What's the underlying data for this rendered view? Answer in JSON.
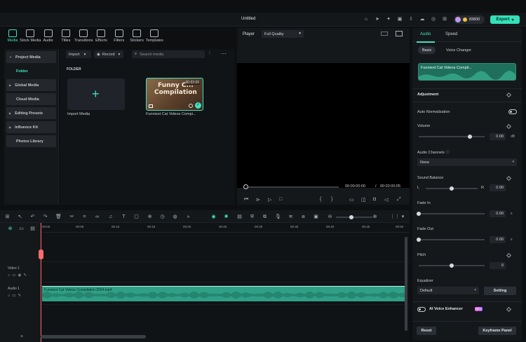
{
  "window": {
    "title": "Untitled"
  },
  "account": {
    "credits": "83830"
  },
  "export": {
    "label": "Export"
  },
  "toolbar": {
    "tools": [
      "Media",
      "Stock Media",
      "Audio",
      "Titles",
      "Transitions",
      "Effects",
      "Filters",
      "Stickers",
      "Templates"
    ],
    "active": "Media"
  },
  "leftnav": {
    "items": [
      "Project Media",
      "Folder",
      "Global Media",
      "Cloud Media",
      "Editing Presets",
      "Influence Kit",
      "Photos Library"
    ]
  },
  "media": {
    "import_label": "Import",
    "record_label": "Record",
    "search_placeholder": "Search media",
    "folder_label": "FOLDER",
    "import_tile_label": "Import Media",
    "clip": {
      "title_line1": "Funny C...",
      "title_line2": "Compilation",
      "duration": "00:02:00",
      "label": "Funniest Cat Videos Compi..."
    }
  },
  "player": {
    "tab": "Player",
    "quality": "Full Quality",
    "current_time": "00:00:00:00",
    "separator": "/",
    "total_time": "00:02:00:05"
  },
  "right": {
    "tabs": [
      "Audio",
      "Speed"
    ],
    "subtabs": [
      "Basic",
      "Voice Changer"
    ],
    "clip_label": "Funniest Cat Videos Compil...",
    "adjustment": "Adjustment",
    "auto_normalization": "Auto Normalization",
    "volume": {
      "label": "Volume",
      "value": "0.00",
      "unit": "dB",
      "level": 0.78
    },
    "audio_channels": {
      "label": "Audio Channels",
      "value": "None"
    },
    "sound_balance": {
      "label": "Sound Balance",
      "left": "L",
      "right": "R",
      "value": "0.00",
      "level": 0.5
    },
    "fade_in": {
      "label": "Fade In",
      "value": "0.00",
      "unit": "s",
      "level": 0.0
    },
    "fade_out": {
      "label": "Fade Out",
      "value": "0.00",
      "unit": "s",
      "level": 0.0
    },
    "pitch": {
      "label": "Pitch",
      "value": "0",
      "level": 0.5
    },
    "equalizer": {
      "label": "Equalizer",
      "value": "Default",
      "setting": "Setting"
    },
    "ai_voice": {
      "label": "AI Voice Enhancer",
      "badge": "NEW"
    },
    "reset": "Reset",
    "keyframe": "Keyframe Panel"
  },
  "timeline": {
    "ticks": [
      "00:00",
      "00:05",
      "00:10",
      "00:15",
      "00:20",
      "00:25",
      "00:30",
      "00:35",
      "00:40",
      "00:45",
      "00:50"
    ],
    "video_track": "Video 1",
    "audio_track": "Audio 1",
    "audio_clip_label": "Funniest Cat Videos Compilation 2024.mp4"
  },
  "colors": {
    "accent": "#3ee2c0",
    "playhead": "#ff5a5a",
    "audio_clip": "#2f9f86",
    "export_bg": "#34e0b8"
  }
}
